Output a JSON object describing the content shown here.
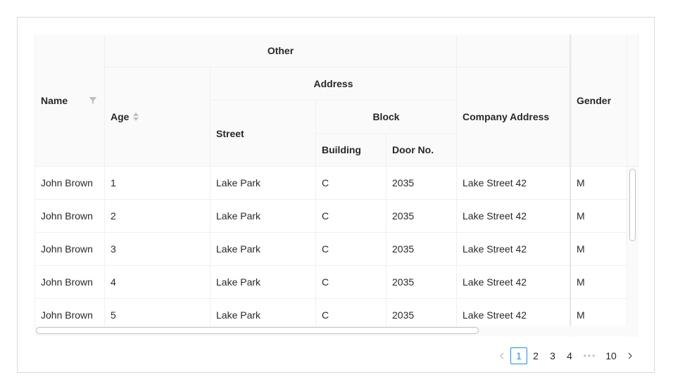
{
  "table": {
    "headers": {
      "name": "Name",
      "other": "Other",
      "age": "Age",
      "address": "Address",
      "street": "Street",
      "block": "Block",
      "building": "Building",
      "door_no": "Door No.",
      "company_address": "Company Address",
      "gender": "Gender"
    },
    "rows": [
      {
        "name": "John Brown",
        "age": "1",
        "street": "Lake Park",
        "building": "C",
        "door_no": "2035",
        "company_address": "Lake Street 42",
        "gender": "M"
      },
      {
        "name": "John Brown",
        "age": "2",
        "street": "Lake Park",
        "building": "C",
        "door_no": "2035",
        "company_address": "Lake Street 42",
        "gender": "M"
      },
      {
        "name": "John Brown",
        "age": "3",
        "street": "Lake Park",
        "building": "C",
        "door_no": "2035",
        "company_address": "Lake Street 42",
        "gender": "M"
      },
      {
        "name": "John Brown",
        "age": "4",
        "street": "Lake Park",
        "building": "C",
        "door_no": "2035",
        "company_address": "Lake Street 42",
        "gender": "M"
      },
      {
        "name": "John Brown",
        "age": "5",
        "street": "Lake Park",
        "building": "C",
        "door_no": "2035",
        "company_address": "Lake Street 42",
        "gender": "M"
      }
    ]
  },
  "pagination": {
    "prev_icon": "chevron-left-icon",
    "next_icon": "chevron-right-icon",
    "pages": [
      "1",
      "2",
      "3",
      "4"
    ],
    "ellipsis": "•••",
    "last_page": "10",
    "current_page": "1"
  },
  "colors": {
    "accent": "#1890ff",
    "header_bg": "#fafafa",
    "border": "#f0f0f0"
  }
}
